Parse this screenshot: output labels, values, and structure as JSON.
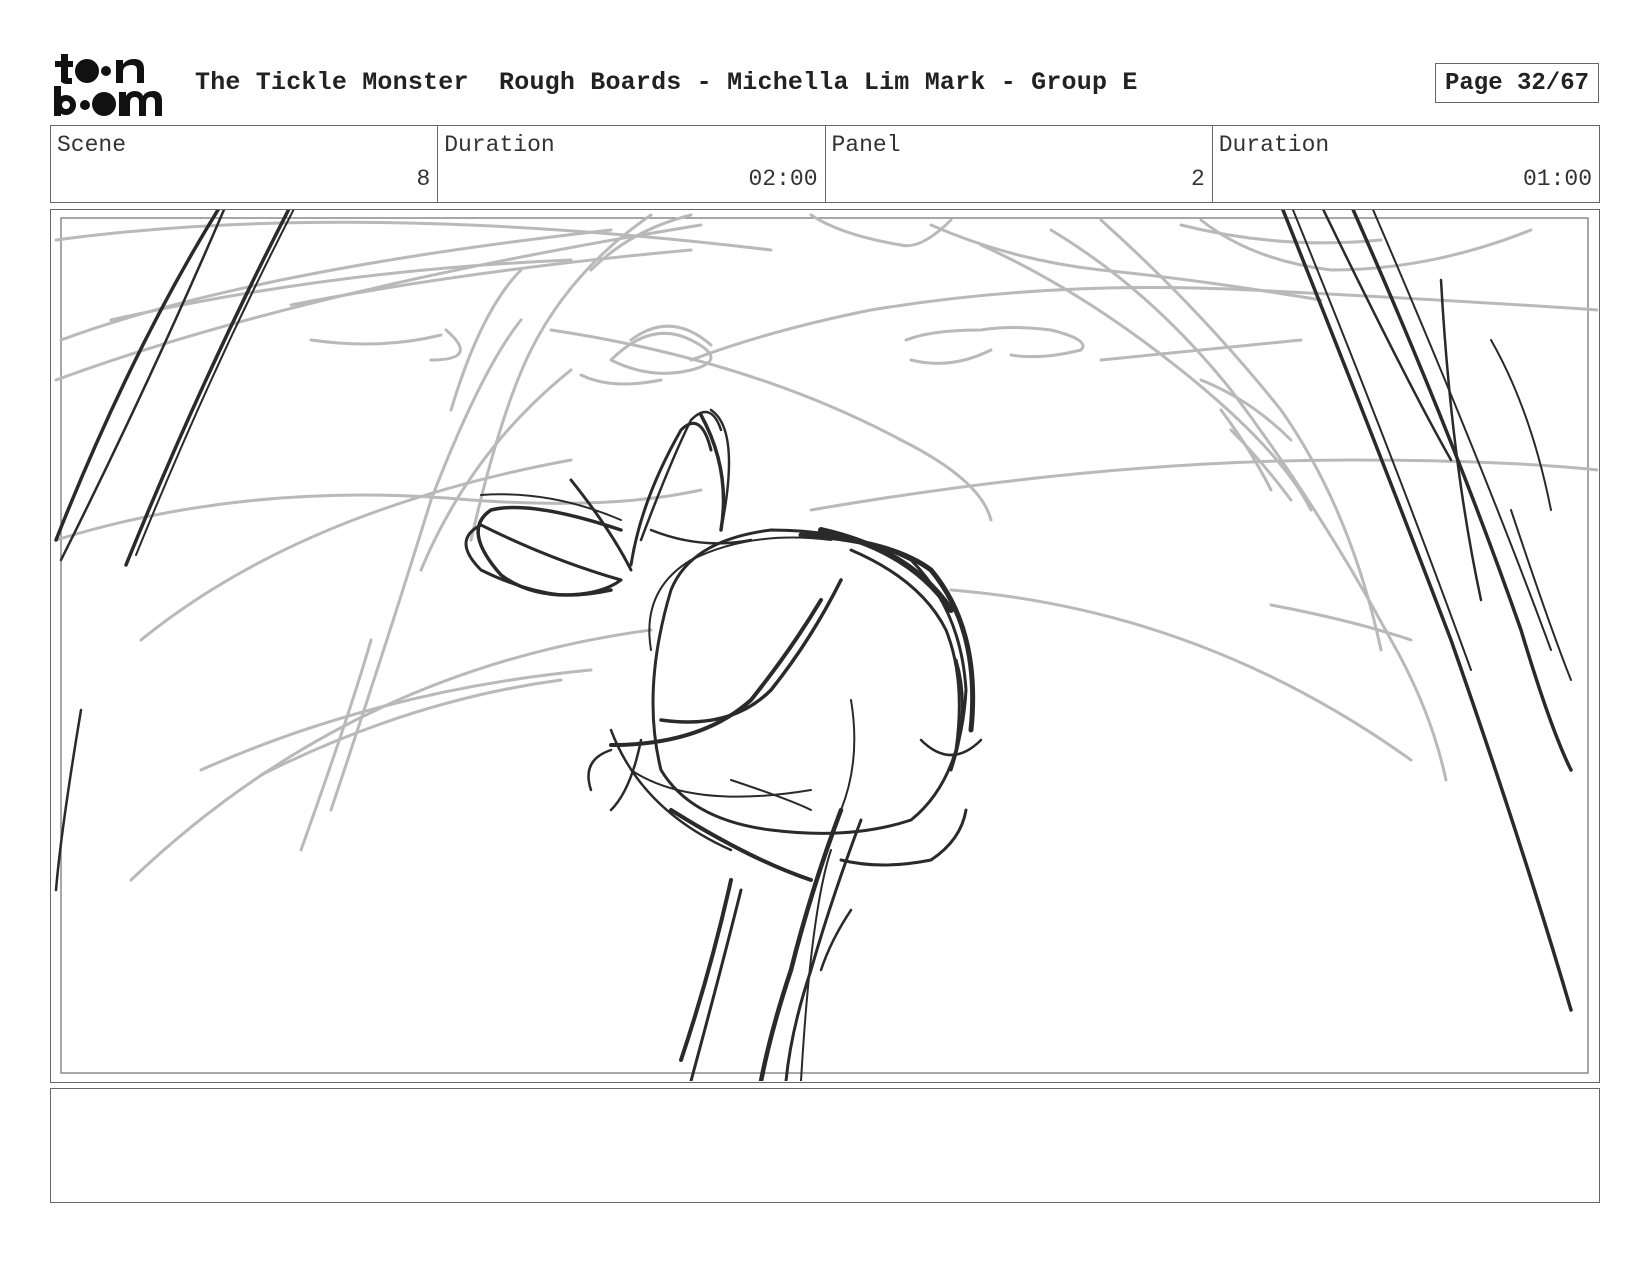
{
  "header": {
    "logo_text": "toon boom",
    "title": "The Tickle Monster  Rough Boards - Michella Lim Mark - Group E",
    "page_label": "Page 32/67"
  },
  "info": {
    "scene_label": "Scene",
    "scene_value": "8",
    "scene_duration_label": "Duration",
    "scene_duration_value": "02:00",
    "panel_label": "Panel",
    "panel_value": "2",
    "panel_duration_label": "Duration",
    "panel_duration_value": "01:00"
  },
  "notes": {
    "text": ""
  },
  "colors": {
    "sketch_light": "#b9b9b9",
    "sketch_dark": "#2a2a2a",
    "border": "#666666"
  }
}
